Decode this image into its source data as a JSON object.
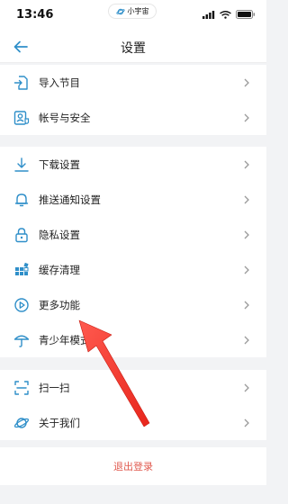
{
  "status_bar": {
    "time": "13:46",
    "pill_text": "小宇宙",
    "icons": [
      "signal-icon",
      "wifi-icon",
      "battery-icon"
    ]
  },
  "header": {
    "title": "设置",
    "back_icon": "back-arrow-icon"
  },
  "groups": [
    {
      "items": [
        {
          "label": "导入节目",
          "icon": "import-icon"
        },
        {
          "label": "帐号与安全",
          "icon": "account-security-icon"
        }
      ]
    },
    {
      "items": [
        {
          "label": "下载设置",
          "icon": "download-icon"
        },
        {
          "label": "推送通知设置",
          "icon": "bell-icon"
        },
        {
          "label": "隐私设置",
          "icon": "lock-icon"
        },
        {
          "label": "缓存清理",
          "icon": "grid-icon"
        },
        {
          "label": "更多功能",
          "icon": "play-circle-icon"
        },
        {
          "label": "青少年模式",
          "icon": "umbrella-icon"
        }
      ]
    },
    {
      "items": [
        {
          "label": "扫一扫",
          "icon": "scan-icon"
        },
        {
          "label": "关于我们",
          "icon": "planet-icon"
        }
      ]
    }
  ],
  "logout": {
    "label": "退出登录"
  },
  "colors": {
    "accent": "#2f8fc9",
    "logout": "#e05a4f",
    "annotation_arrow": "#ff3b30"
  }
}
